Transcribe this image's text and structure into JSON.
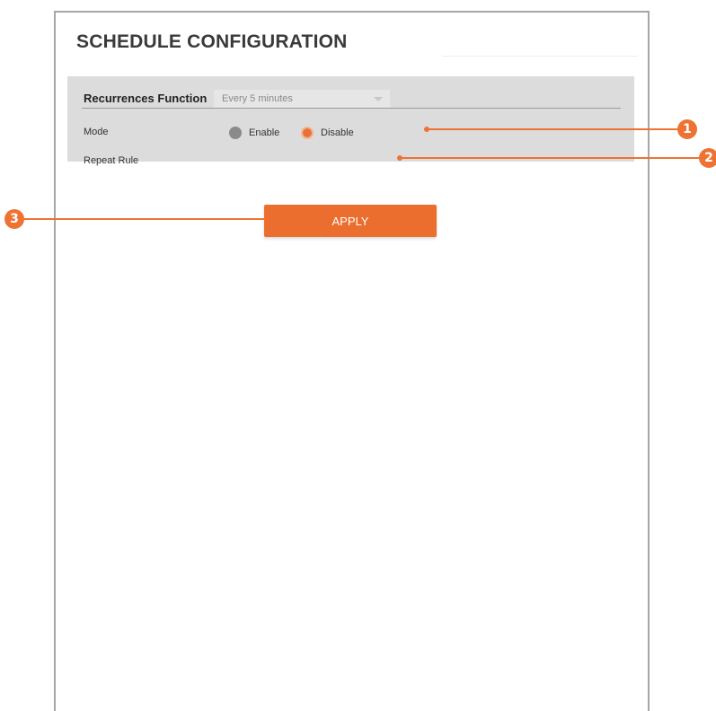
{
  "page": {
    "title": "SCHEDULE CONFIGURATION"
  },
  "section": {
    "title": "Recurrences Function",
    "mode": {
      "label": "Mode",
      "options": [
        {
          "label": "Enable",
          "selected": false
        },
        {
          "label": "Disable",
          "selected": true
        }
      ]
    },
    "repeat_rule": {
      "label": "Repeat Rule",
      "value": "Every 5 minutes"
    }
  },
  "apply_button": {
    "label": "APPLY"
  },
  "callouts": [
    "1",
    "2",
    "3"
  ],
  "colors": {
    "accent": "#ec6e2e",
    "section_bg": "#dcdcdc",
    "radio_unselected": "#8a8a8a"
  }
}
